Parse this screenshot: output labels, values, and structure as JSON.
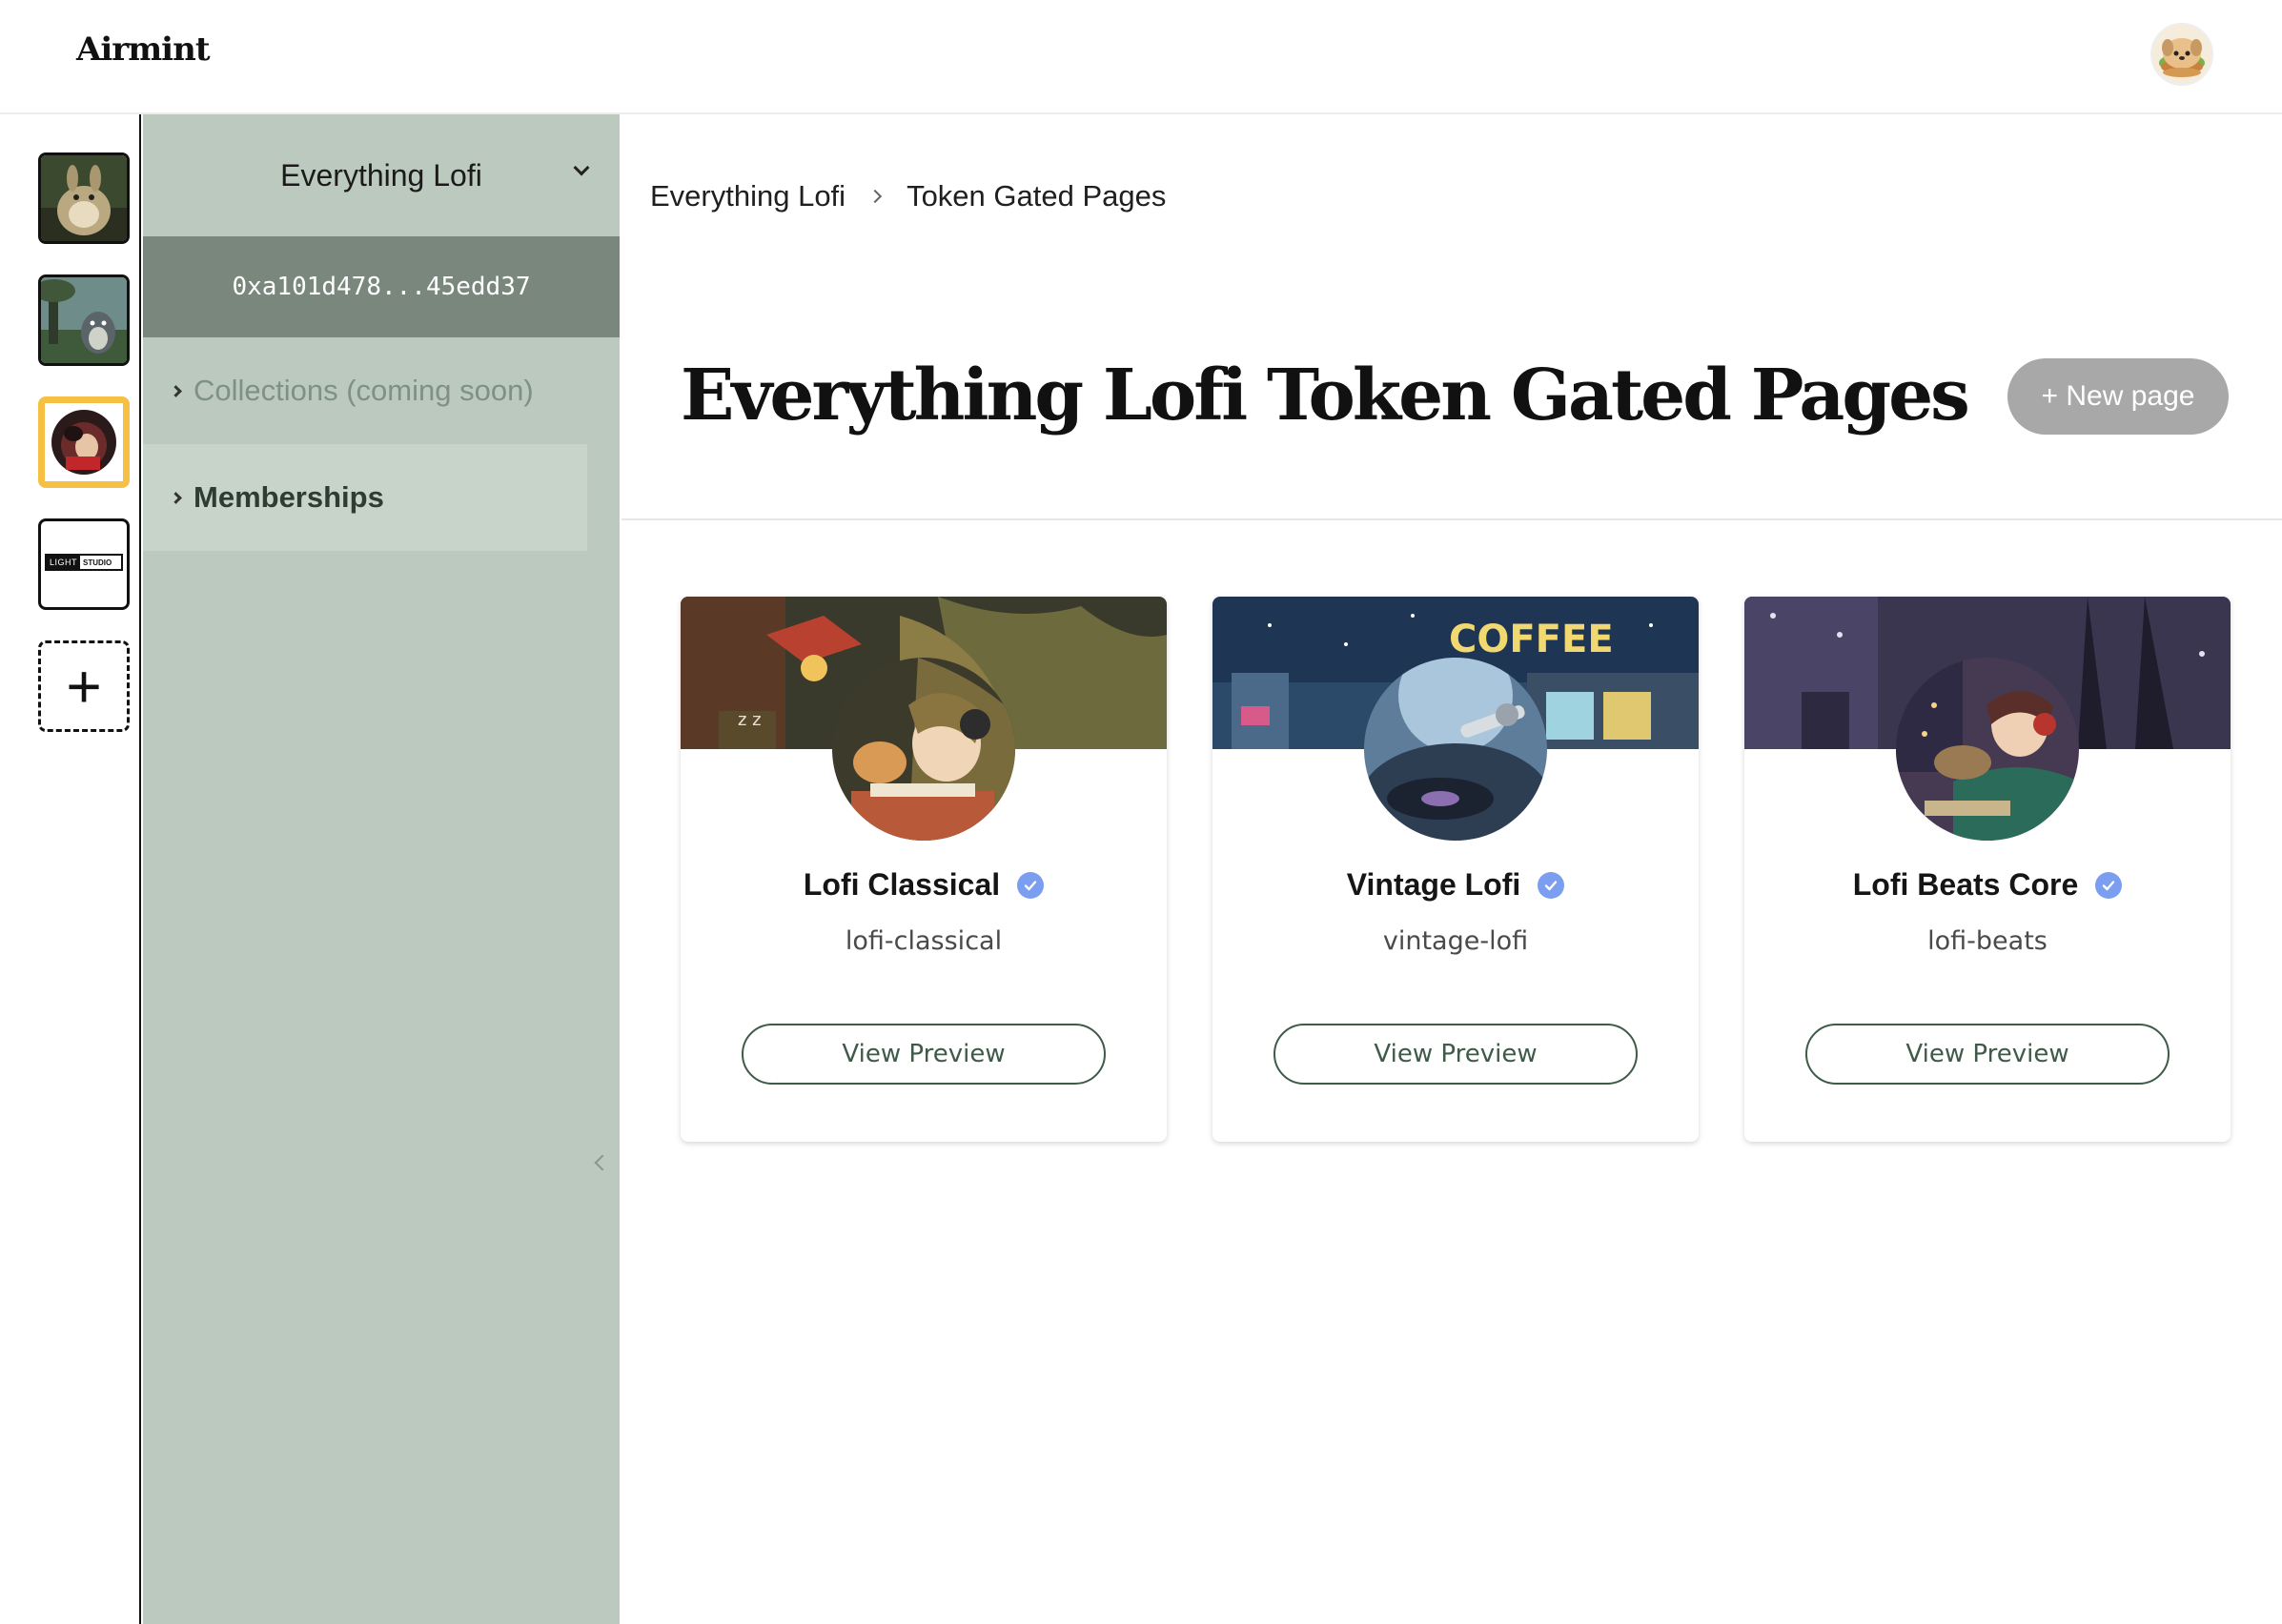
{
  "header": {
    "logo": "Airmint",
    "user_avatar_icon": "burger-dog-avatar"
  },
  "rail": {
    "projects": [
      {
        "name": "project-rabbit-creature",
        "icon": "rabbit-creature-thumbnail"
      },
      {
        "name": "project-forest-spirit",
        "icon": "forest-spirit-thumbnail"
      },
      {
        "name": "project-everything-lofi",
        "icon": "lofi-character-thumbnail",
        "selected": true
      },
      {
        "name": "project-light-studio",
        "icon": "light-studio-logo",
        "logo_text_left": "LIGHT",
        "logo_text_right": "STUDIO"
      }
    ],
    "add_label": "+"
  },
  "sidebar": {
    "project_name": "Everything Lofi",
    "wallet": "0xa101d478...45edd37",
    "items": [
      {
        "label": "Collections (coming soon)"
      },
      {
        "label": "Memberships"
      }
    ]
  },
  "breadcrumb": {
    "items": [
      "Everything Lofi",
      "Token Gated Pages"
    ]
  },
  "page": {
    "title": "Everything Lofi Token Gated Pages",
    "new_page_label": "+ New page"
  },
  "cards": [
    {
      "title": "Lofi Classical",
      "slug": "lofi-classical",
      "button": "View Preview",
      "verified": true
    },
    {
      "title": "Vintage Lofi",
      "slug": "vintage-lofi",
      "button": "View Preview",
      "verified": true,
      "banner_sign": "COFFEE"
    },
    {
      "title": "Lofi Beats Core",
      "slug": "lofi-beats",
      "button": "View Preview",
      "verified": true
    }
  ],
  "colors": {
    "sidebar_bg": "#bcc9bf",
    "wallet_bg": "#7a877d",
    "memberships_bg": "#c8d3ca",
    "accent_green": "#3e5a48",
    "verified_blue": "#7b9ef0",
    "selected_border": "#f5c044",
    "new_page_bg": "#a8a8a8"
  }
}
